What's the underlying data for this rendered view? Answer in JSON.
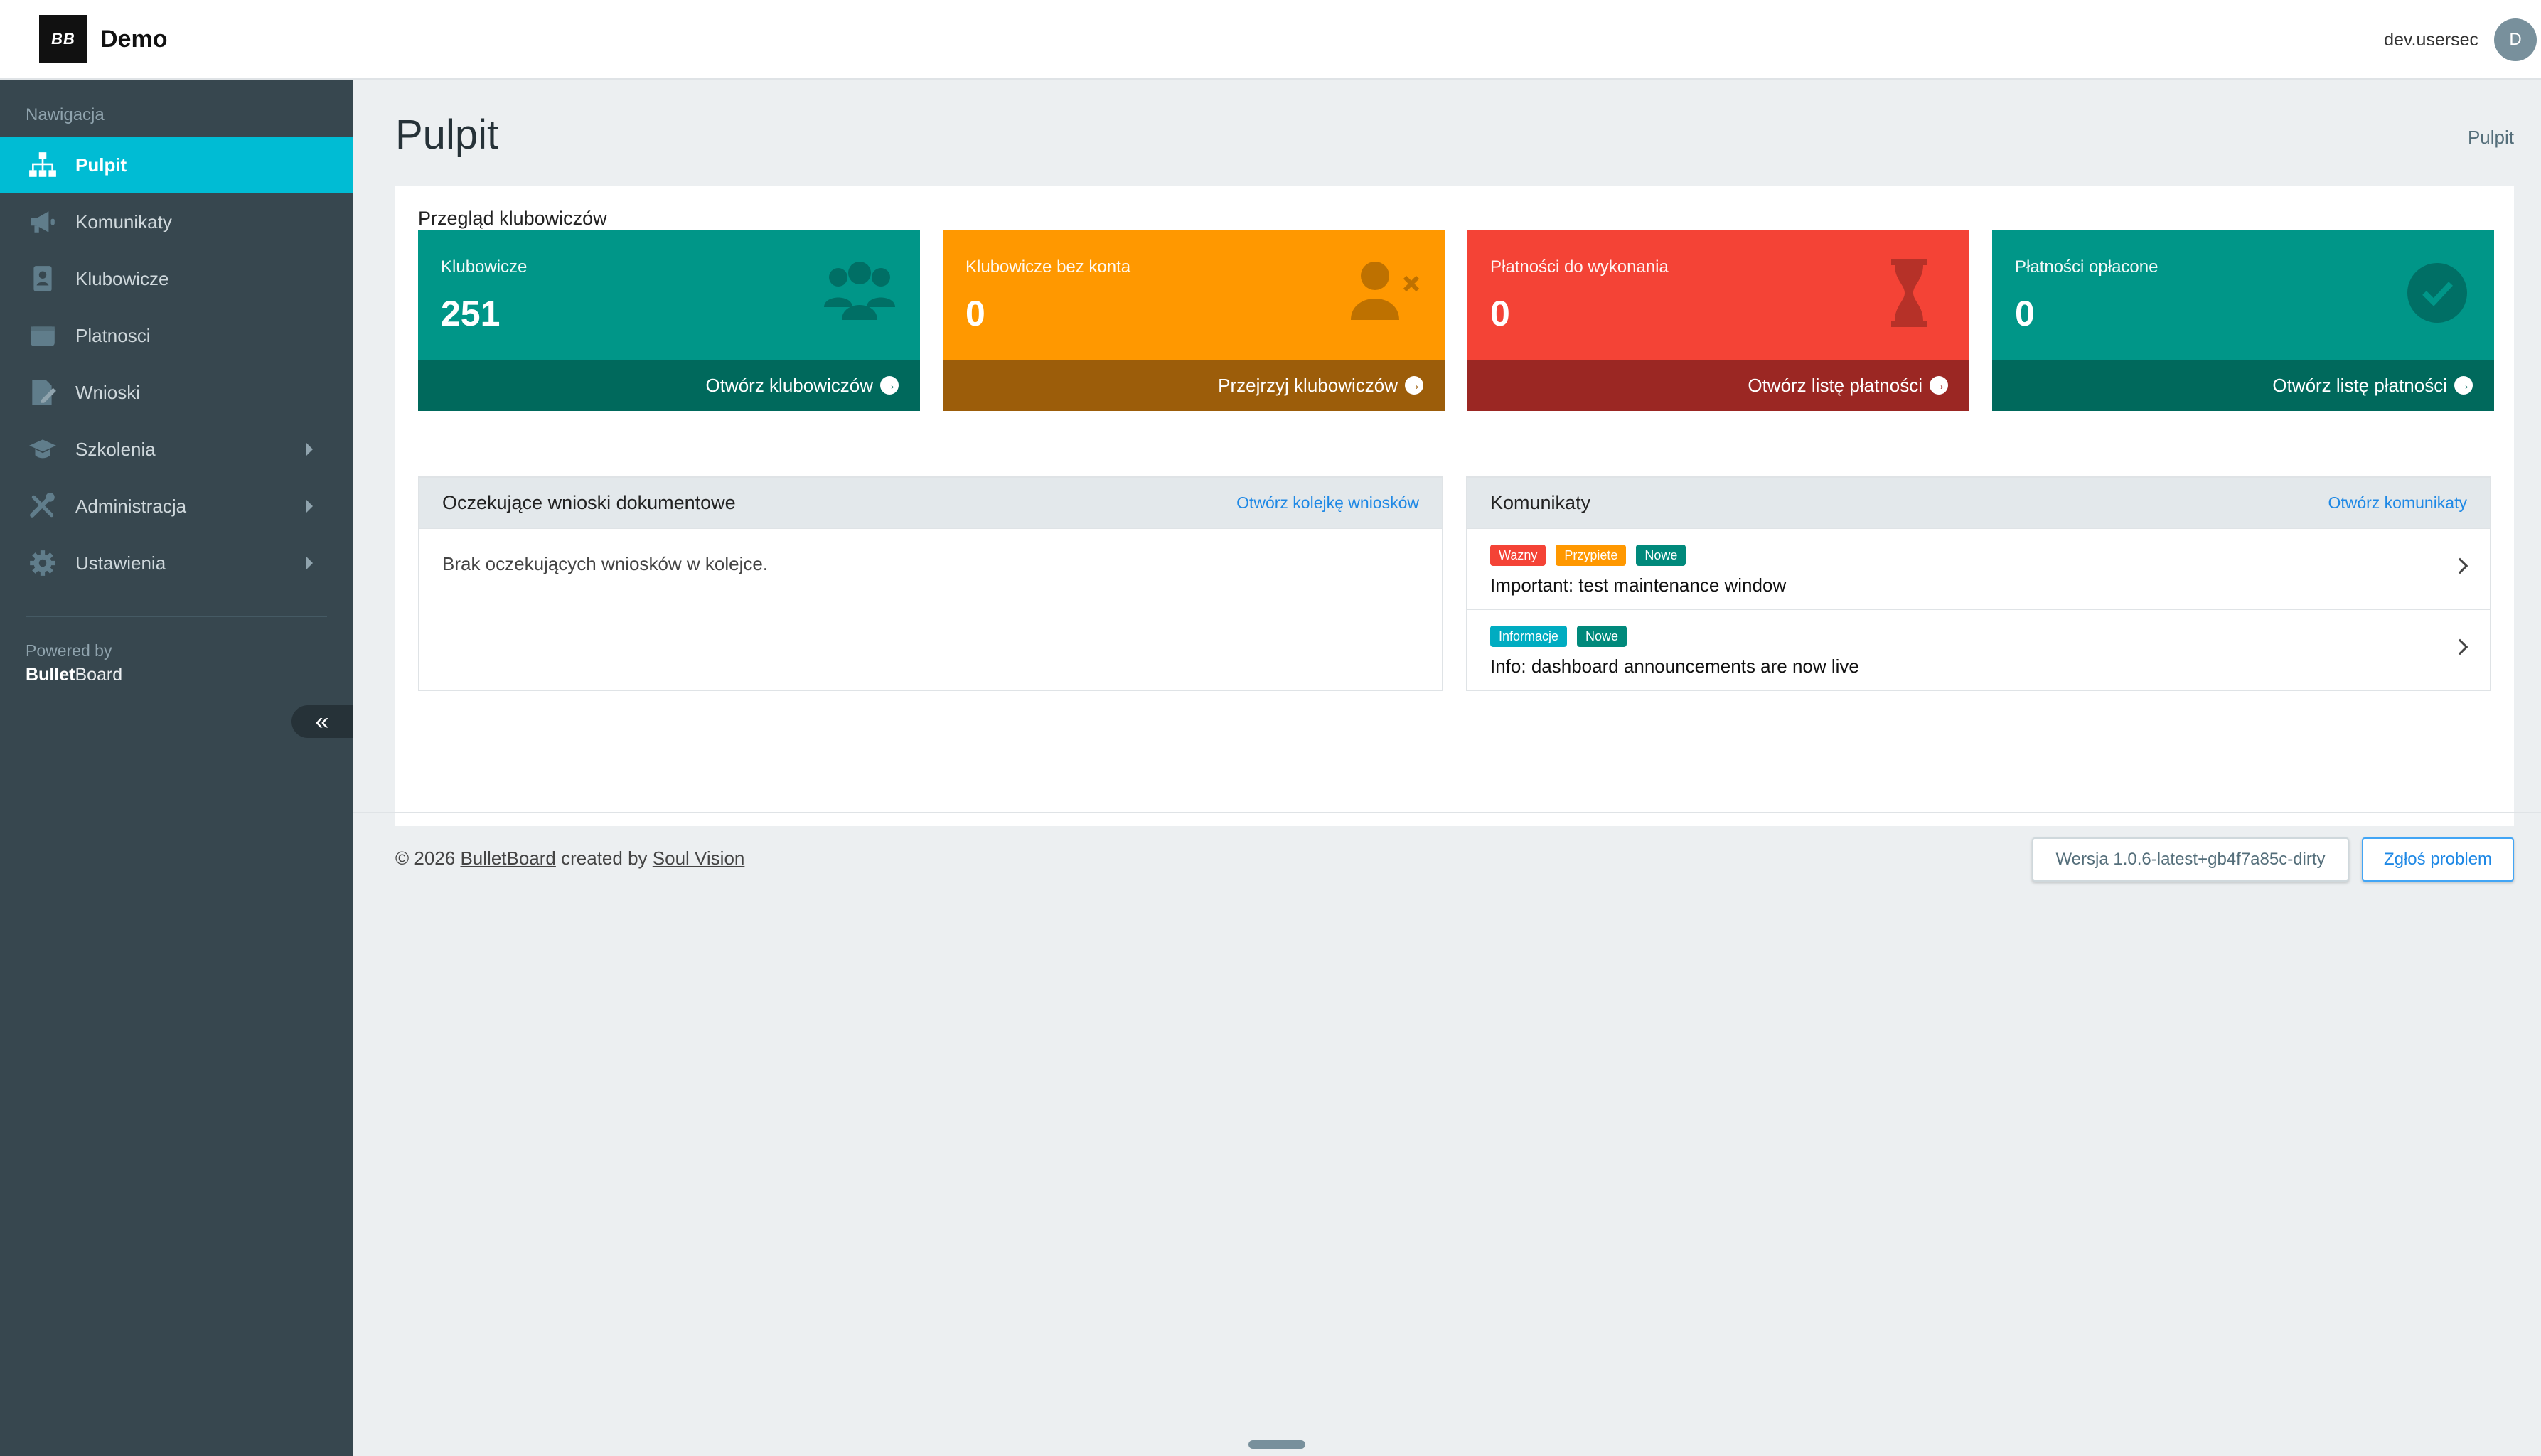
{
  "app": {
    "logo_text": "BB",
    "name": "Demo"
  },
  "user": {
    "name": "dev.usersec",
    "initial": "D"
  },
  "sidebar": {
    "heading": "Nawigacja",
    "items": [
      {
        "label": "Pulpit",
        "icon": "sitemap-icon",
        "active": true
      },
      {
        "label": "Komunikaty",
        "icon": "megaphone-icon"
      },
      {
        "label": "Klubowicze",
        "icon": "address-book-icon"
      },
      {
        "label": "Platnosci",
        "icon": "wallet-icon"
      },
      {
        "label": "Wnioski",
        "icon": "file-signature-icon"
      },
      {
        "label": "Szkolenia",
        "icon": "graduation-cap-icon",
        "submenu": true
      },
      {
        "label": "Administracja",
        "icon": "tools-icon",
        "submenu": true
      },
      {
        "label": "Ustawienia",
        "icon": "gear-icon",
        "submenu": true
      }
    ],
    "powered_by": "Powered by",
    "powered_brand_bold": "Bullet",
    "powered_brand_rest": "Board",
    "collapse_icon": "angles-left-icon"
  },
  "page": {
    "title": "Pulpit",
    "breadcrumb": "Pulpit"
  },
  "overview": {
    "title": "Przegląd klubowiczów",
    "stats": [
      {
        "label": "Klubowicze",
        "value": "251",
        "link": "Otwórz klubowiczów",
        "icon": "users-icon",
        "color": "#009688",
        "foot_color": "#00695c"
      },
      {
        "label": "Klubowicze bez konta",
        "value": "0",
        "link": "Przejrzyj klubowiczów",
        "icon": "user-x-icon",
        "color": "#ff9800",
        "foot_color": "#9c5d0a"
      },
      {
        "label": "Płatności do wykonania",
        "value": "0",
        "link": "Otwórz listę płatności",
        "icon": "hourglass-icon",
        "color": "#f44336",
        "foot_color": "#9b2723"
      },
      {
        "label": "Płatności opłacone",
        "value": "0",
        "link": "Otwórz listę płatności",
        "icon": "check-circle-icon",
        "color": "#009688",
        "foot_color": "#00695c"
      }
    ]
  },
  "requests": {
    "title": "Oczekujące wnioski dokumentowe",
    "link": "Otwórz kolejkę wniosków",
    "empty": "Brak oczekujących wniosków w kolejce."
  },
  "announcements": {
    "title": "Komunikaty",
    "link": "Otwórz komunikaty",
    "items": [
      {
        "badges": [
          {
            "text": "Wazny",
            "color": "#f44336"
          },
          {
            "text": "Przypiete",
            "color": "#ff9800"
          },
          {
            "text": "Nowe",
            "color": "#00897b"
          }
        ],
        "text": "Important: test maintenance window"
      },
      {
        "badges": [
          {
            "text": "Informacje",
            "color": "#00acc1"
          },
          {
            "text": "Nowe",
            "color": "#00897b"
          }
        ],
        "text": "Info: dashboard announcements are now live"
      }
    ]
  },
  "footer": {
    "copyright": "© 2026",
    "brand_link": "BulletBoard",
    "created_by": "created by",
    "author_link": "Soul Vision",
    "version_button": "Wersja 1.0.6-latest+gb4f7a85c-dirty",
    "report_button": "Zgłoś problem"
  }
}
